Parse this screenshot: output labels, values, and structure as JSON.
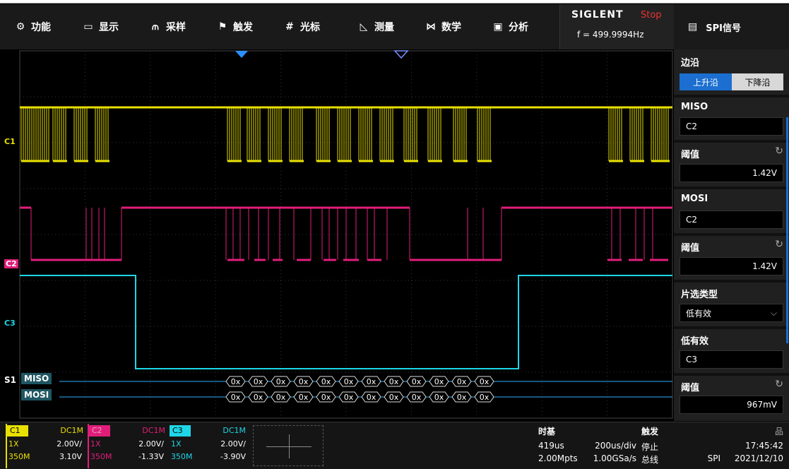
{
  "menu": [
    {
      "icon": "gear-icon",
      "glyph": "⚙",
      "label": "功能"
    },
    {
      "icon": "display-icon",
      "glyph": "▭",
      "label": "显示"
    },
    {
      "icon": "acquire-icon",
      "glyph": "⫙",
      "label": "采样"
    },
    {
      "icon": "trigger-flag-icon",
      "glyph": "⚑",
      "label": "触发"
    },
    {
      "icon": "cursor-icon",
      "glyph": "#",
      "label": "光标"
    },
    {
      "icon": "measure-icon",
      "glyph": "◺",
      "label": "测量"
    },
    {
      "icon": "math-icon",
      "glyph": "⋈",
      "label": "数学"
    },
    {
      "icon": "analysis-icon",
      "glyph": "▣",
      "label": "分析"
    }
  ],
  "brand": {
    "name": "SIGLENT",
    "status": "Stop",
    "frequency": "f = 499.9994Hz"
  },
  "panel": {
    "title": "SPI信号",
    "edge_label": "边沿",
    "edge_rise": "上升沿",
    "edge_fall": "下降沿",
    "miso_label": "MISO",
    "miso_source": "C2",
    "miso_thresh_label": "阈值",
    "miso_thresh": "1.42V",
    "mosi_label": "MOSI",
    "mosi_source": "C2",
    "mosi_thresh_label": "阈值",
    "mosi_thresh": "1.42V",
    "cs_type_label": "片选类型",
    "cs_type": "低有效",
    "cs_label": "低有效",
    "cs_source": "C3",
    "cs_thresh_label": "阈值",
    "cs_thresh": "967mV"
  },
  "screen": {
    "c1_tag": "C1",
    "c2_tag": "C2",
    "c3_tag": "C3",
    "bus_id": "S1",
    "miso_bus": "MISO",
    "mosi_bus": "MOSI",
    "decode_text": "0x",
    "colors": {
      "c1": "#e8e000",
      "c2": "#e01e7a",
      "c3": "#1ed6e6",
      "bus": "#2ab0ff"
    }
  },
  "channels": [
    {
      "tag": "C1",
      "coupling": "DC1M",
      "probe": "1X",
      "scale": "2.00V/",
      "bandwidth": "350M",
      "offset": "3.10V"
    },
    {
      "tag": "C2",
      "coupling": "DC1M",
      "probe": "1X",
      "scale": "2.00V/",
      "bandwidth": "350M",
      "offset": "-1.33V"
    },
    {
      "tag": "C3",
      "coupling": "DC1M",
      "probe": "1X",
      "scale": "2.00V/",
      "bandwidth": "350M",
      "offset": "-3.90V"
    }
  ],
  "timebase": {
    "label": "时基",
    "delay": "419us",
    "per_div": "200us/div",
    "points": "2.00Mpts",
    "rate": "1.00GSa/s"
  },
  "trigger": {
    "label": "触发",
    "state": "停止",
    "type": "总线",
    "source": "SPI"
  },
  "clock": {
    "icon": "network-icon",
    "time": "17:45:42",
    "date": "2021/12/10"
  }
}
